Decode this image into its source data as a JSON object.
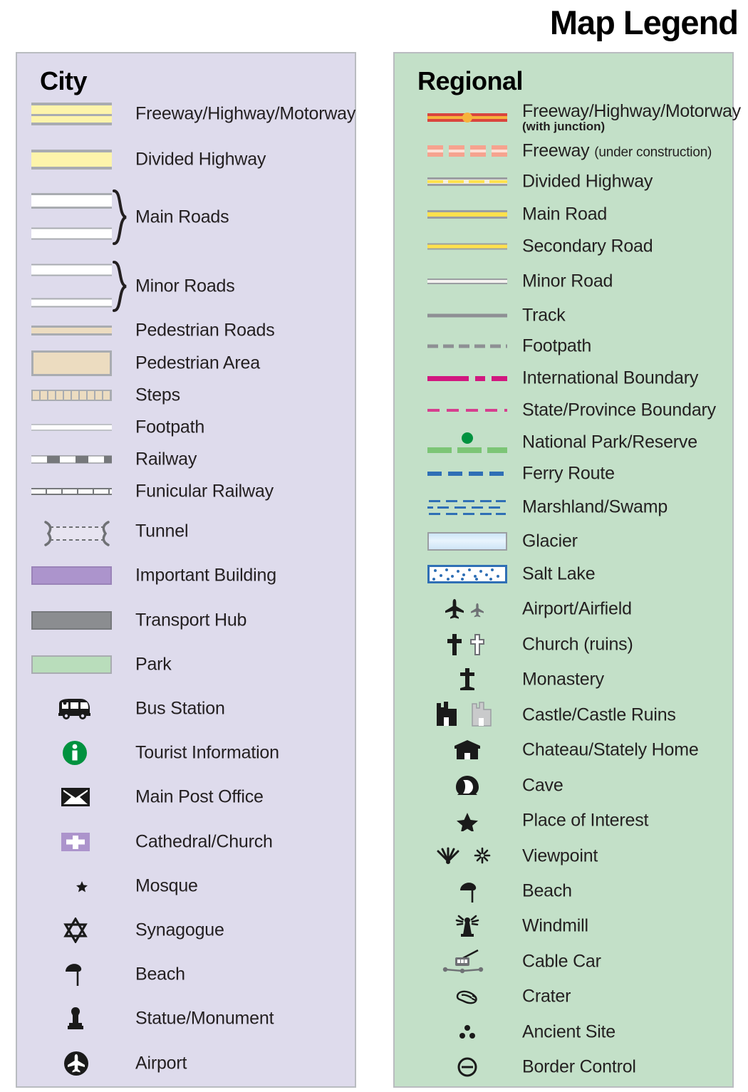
{
  "title": "Map Legend",
  "city": {
    "heading": "City",
    "items": [
      {
        "label": "Freeway/Highway/Motorway",
        "symbol": "freeway-swatch"
      },
      {
        "label": "Divided Highway",
        "symbol": "divided-highway-swatch"
      },
      {
        "label": "Main Roads",
        "symbol": "main-roads-swatch-pair"
      },
      {
        "label": "Minor Roads",
        "symbol": "minor-roads-swatch-pair"
      },
      {
        "label": "Pedestrian Roads",
        "symbol": "pedestrian-road-swatch"
      },
      {
        "label": "Pedestrian Area",
        "symbol": "pedestrian-area-swatch"
      },
      {
        "label": "Steps",
        "symbol": "steps-swatch"
      },
      {
        "label": "Footpath",
        "symbol": "footpath-swatch"
      },
      {
        "label": "Railway",
        "symbol": "railway-swatch"
      },
      {
        "label": "Funicular Railway",
        "symbol": "funicular-railway-swatch"
      },
      {
        "label": "Tunnel",
        "symbol": "tunnel-swatch"
      },
      {
        "label": "Important Building",
        "symbol": "important-building-swatch"
      },
      {
        "label": "Transport Hub",
        "symbol": "transport-hub-swatch"
      },
      {
        "label": "Park",
        "symbol": "park-swatch"
      },
      {
        "label": "Bus Station",
        "symbol": "bus-icon"
      },
      {
        "label": "Tourist Information",
        "symbol": "information-icon"
      },
      {
        "label": "Main Post Office",
        "symbol": "envelope-icon"
      },
      {
        "label": "Cathedral/Church",
        "symbol": "cross-badge-icon"
      },
      {
        "label": "Mosque",
        "symbol": "star-and-crescent-icon"
      },
      {
        "label": "Synagogue",
        "symbol": "star-of-david-icon"
      },
      {
        "label": "Beach",
        "symbol": "beach-umbrella-icon"
      },
      {
        "label": "Statue/Monument",
        "symbol": "statue-icon"
      },
      {
        "label": "Airport",
        "symbol": "airport-circle-icon"
      }
    ]
  },
  "regional": {
    "heading": "Regional",
    "items": [
      {
        "label": "Freeway/Highway/Motorway",
        "sublabel": "(with junction)",
        "symbol": "freeway-junction-line"
      },
      {
        "label": "Freeway",
        "sublabel": "(under construction)",
        "symbol": "freeway-construction-line"
      },
      {
        "label": "Divided Highway",
        "symbol": "divided-highway-line"
      },
      {
        "label": "Main Road",
        "symbol": "main-road-line"
      },
      {
        "label": "Secondary Road",
        "symbol": "secondary-road-line"
      },
      {
        "label": "Minor Road",
        "symbol": "minor-road-line"
      },
      {
        "label": "Track",
        "symbol": "track-line"
      },
      {
        "label": "Footpath",
        "symbol": "footpath-dashed-line"
      },
      {
        "label": "International Boundary",
        "symbol": "international-boundary-line"
      },
      {
        "label": "State/Province Boundary",
        "symbol": "state-boundary-line"
      },
      {
        "label": "National Park/Reserve",
        "symbol": "national-park-line"
      },
      {
        "label": "Ferry Route",
        "symbol": "ferry-route-line"
      },
      {
        "label": "Marshland/Swamp",
        "symbol": "marshland-pattern"
      },
      {
        "label": "Glacier",
        "symbol": "glacier-swatch"
      },
      {
        "label": "Salt Lake",
        "symbol": "salt-lake-swatch"
      },
      {
        "label": "Airport/Airfield",
        "symbol": "airplane-icons"
      },
      {
        "label": "Church (ruins)",
        "symbol": "church-cross-icons"
      },
      {
        "label": "Monastery",
        "symbol": "monastery-cross-icon"
      },
      {
        "label": "Castle/Castle Ruins",
        "symbol": "castle-icons"
      },
      {
        "label": "Chateau/Stately Home",
        "symbol": "chateau-icon"
      },
      {
        "label": "Cave",
        "symbol": "cave-icon"
      },
      {
        "label": "Place of Interest",
        "symbol": "star-icon"
      },
      {
        "label": "Viewpoint",
        "symbol": "viewpoint-icons"
      },
      {
        "label": "Beach",
        "symbol": "beach-umbrella-icon"
      },
      {
        "label": "Windmill",
        "symbol": "windmill-icon"
      },
      {
        "label": "Cable Car",
        "symbol": "cable-car-icon"
      },
      {
        "label": "Crater",
        "symbol": "crater-icon"
      },
      {
        "label": "Ancient Site",
        "symbol": "ancient-site-icon"
      },
      {
        "label": "Border Control",
        "symbol": "border-control-icon"
      }
    ]
  },
  "colors": {
    "city_panel_bg": "#dedbec",
    "regional_panel_bg": "#c3e0c8",
    "panel_border": "#b9bcc0",
    "road_yellow": "#fdf4ab",
    "road_yellow_strong": "#ffe14d",
    "pedestrian_tan": "#ecdcc0",
    "grey_casing": "#a9acb1",
    "important_building_purple": "#ac94cc",
    "transport_hub_grey": "#8b8d90",
    "park_green": "#b9ddbb",
    "freeway_red": "#d9453e",
    "junction_orange": "#f7b23c",
    "boundary_magenta": "#d1177f",
    "national_park_green": "#7cc576",
    "ferry_blue": "#2f6fb5",
    "info_green": "#00923f",
    "text": "#231f20"
  }
}
